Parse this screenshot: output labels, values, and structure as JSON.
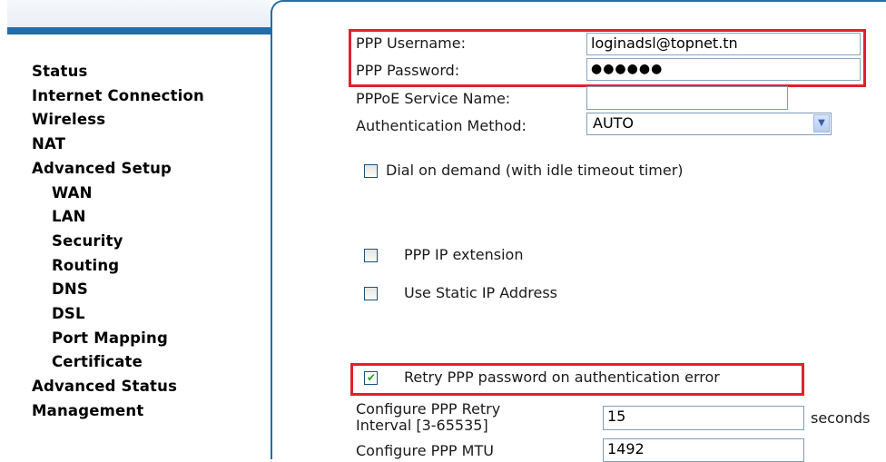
{
  "sidebar": {
    "items": [
      {
        "label": "Status",
        "sub": false
      },
      {
        "label": "Internet Connection",
        "sub": false
      },
      {
        "label": "Wireless",
        "sub": false
      },
      {
        "label": "NAT",
        "sub": false
      },
      {
        "label": "Advanced Setup",
        "sub": false
      },
      {
        "label": "WAN",
        "sub": true
      },
      {
        "label": "LAN",
        "sub": true
      },
      {
        "label": "Security",
        "sub": true
      },
      {
        "label": "Routing",
        "sub": true
      },
      {
        "label": "DNS",
        "sub": true
      },
      {
        "label": "DSL",
        "sub": true
      },
      {
        "label": "Port Mapping",
        "sub": true
      },
      {
        "label": "Certificate",
        "sub": true
      },
      {
        "label": "Advanced Status",
        "sub": false
      },
      {
        "label": "Management",
        "sub": false
      }
    ]
  },
  "form": {
    "username_label": "PPP Username:",
    "username_value": "loginadsl@topnet.tn",
    "password_label": "PPP Password:",
    "password_value": "●●●●●●",
    "service_name_label": "PPPoE Service Name:",
    "service_name_value": "",
    "auth_method_label": "Authentication Method:",
    "auth_method_value": "AUTO",
    "dial_on_demand_label": "Dial on demand (with idle timeout timer)",
    "ppp_ip_extension_label": "PPP IP extension",
    "static_ip_label": "Use Static IP Address",
    "retry_label": "Retry PPP password on authentication error",
    "retry_interval_label_1": "Configure PPP Retry",
    "retry_interval_label_2": "Interval [3-65535]",
    "retry_interval_value": "15",
    "retry_interval_unit": "seconds",
    "mtu_label": "Configure PPP MTU",
    "mtu_value": "1492"
  },
  "colors": {
    "accent": "#1f6fa8",
    "highlight": "#e3202a"
  }
}
